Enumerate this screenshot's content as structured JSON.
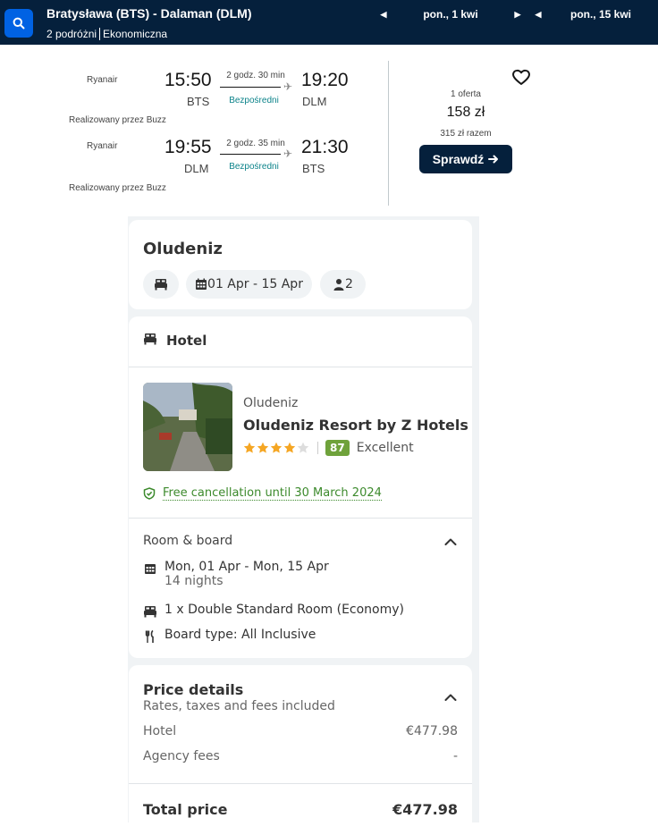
{
  "header": {
    "route": "Bratysława (BTS) - Dalaman (DLM)",
    "travellers": "2 podróżni",
    "cabin": "Ekonomiczna",
    "depart_date": "pon., 1 kwi",
    "return_date": "pon., 15 kwi"
  },
  "flight": {
    "outbound": {
      "airline": "Ryanair",
      "depart_time": "15:50",
      "depart_code": "BTS",
      "duration": "2 godz. 30 min",
      "stops": "Bezpośredni",
      "arrive_time": "19:20",
      "arrive_code": "DLM",
      "operated_by": "Realizowany przez Buzz"
    },
    "inbound": {
      "airline": "Ryanair",
      "depart_time": "19:55",
      "depart_code": "DLM",
      "duration": "2 godz. 35 min",
      "stops": "Bezpośredni",
      "arrive_time": "21:30",
      "arrive_code": "BTS",
      "operated_by": "Realizowany przez Buzz"
    },
    "offer": {
      "count": "1 oferta",
      "price": "158 zł",
      "total": "315 zł razem",
      "cta": "Sprawdź"
    }
  },
  "package": {
    "destination": "Oludeniz",
    "dates": "01 Apr - 15 Apr",
    "guests": "2",
    "hotel_section": "Hotel",
    "hotel": {
      "city": "Oludeniz",
      "name": "Oludeniz Resort by Z Hotels",
      "stars": 4,
      "max_stars": 5,
      "score": "87",
      "score_label": "Excellent",
      "cancellation": "Free cancellation until 30 March 2024"
    },
    "room_board": {
      "label": "Room & board",
      "dates": "Mon, 01 Apr - Mon, 15 Apr",
      "nights": "14 nights",
      "room": "1 x Double Standard Room (Economy)",
      "board": "Board type: All Inclusive"
    },
    "price_details": {
      "title": "Price details",
      "subtitle": "Rates, taxes and fees included",
      "hotel_label": "Hotel",
      "hotel_value": "€477.98",
      "fees_label": "Agency fees",
      "fees_value": "-",
      "total_label": "Total price",
      "total_value": "€477.98"
    }
  },
  "colors": {
    "header_bg": "#05203c",
    "search_button": "#0062e3",
    "star": "#f5a623",
    "score_badge": "#6fa23b",
    "cancellation": "#3c8a2c",
    "direct": "#0c838a"
  },
  "icons": [
    "search-icon",
    "arrow-left-icon",
    "arrow-right-icon",
    "plane-icon",
    "heart-icon",
    "arrow-icon",
    "bed-icon",
    "calendar-icon",
    "person-icon",
    "star-icon",
    "shield-check-icon",
    "chevron-up-icon",
    "cutlery-icon"
  ]
}
